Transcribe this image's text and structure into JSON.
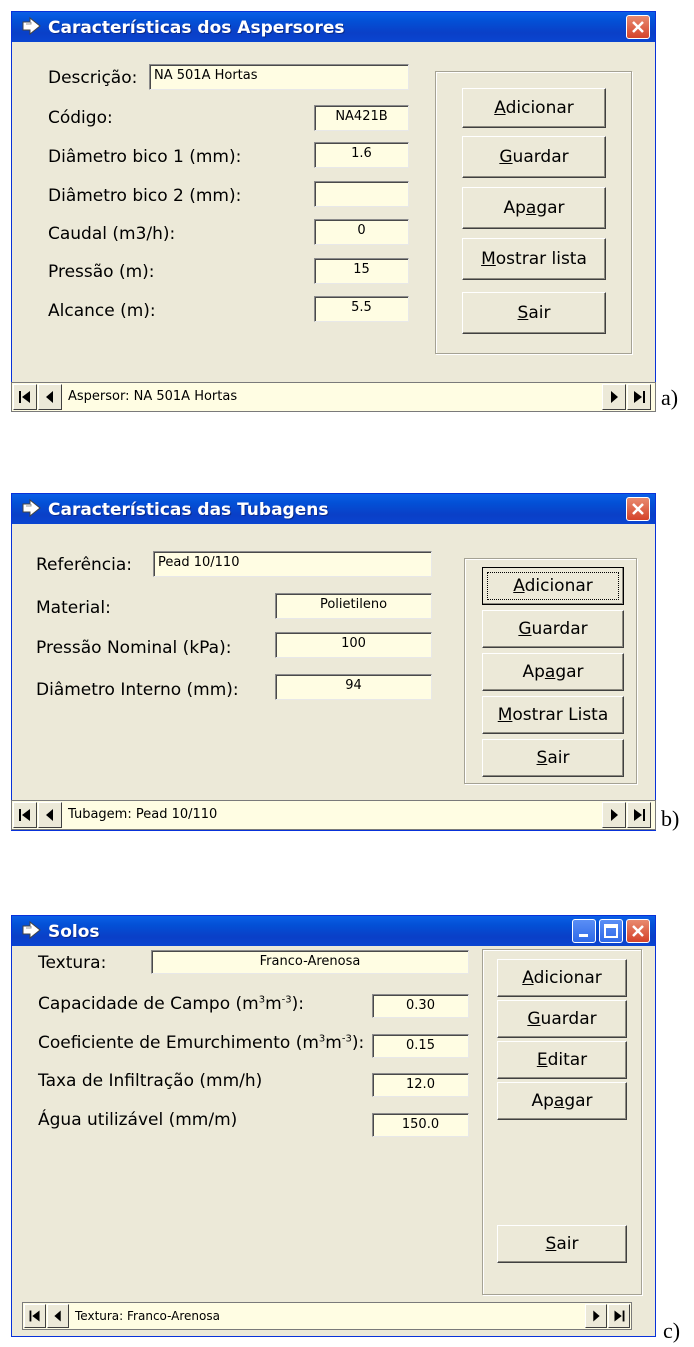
{
  "window_a": {
    "title": "Características dos Aspersores",
    "labels": {
      "descricao": "Descrição:",
      "codigo": "Código:",
      "diametro1": "Diâmetro bico 1 (mm):",
      "diametro2": "Diâmetro bico 2 (mm):",
      "caudal": "Caudal (m3/h):",
      "pressao": "Pressão (m):",
      "alcance": "Alcance (m):"
    },
    "values": {
      "descricao": "NA 501A Hortas",
      "codigo": "NA421B",
      "diametro1": "1.6",
      "diametro2": "",
      "caudal": "0",
      "pressao": "15",
      "alcance": "5.5"
    },
    "buttons": {
      "adicionar": {
        "pre": "",
        "u": "A",
        "post": "dicionar"
      },
      "guardar": {
        "pre": "",
        "u": "G",
        "post": "uardar"
      },
      "apagar": {
        "pre": "Ap",
        "u": "a",
        "post": "gar"
      },
      "mostrar": {
        "pre": "",
        "u": "M",
        "post": "ostrar lista"
      },
      "sair": {
        "pre": "",
        "u": "S",
        "post": "air"
      }
    },
    "nav_text": "Aspersor: NA 501A Hortas",
    "caption": "a)"
  },
  "window_b": {
    "title": "Características das Tubagens",
    "labels": {
      "referencia": "Referência:",
      "material": "Material:",
      "pressao": "Pressão Nominal (kPa):",
      "diametro": "Diâmetro Interno (mm):"
    },
    "values": {
      "referencia": "Pead 10/110",
      "material": "Polietileno",
      "pressao": "100",
      "diametro": "94"
    },
    "buttons": {
      "adicionar": {
        "pre": "",
        "u": "A",
        "post": "dicionar"
      },
      "guardar": {
        "pre": "",
        "u": "G",
        "post": "uardar"
      },
      "apagar": {
        "pre": "Ap",
        "u": "a",
        "post": "gar"
      },
      "mostrar": {
        "pre": "",
        "u": "M",
        "post": "ostrar Lista"
      },
      "sair": {
        "pre": "",
        "u": "S",
        "post": "air"
      }
    },
    "nav_text": "Tubagem: Pead 10/110",
    "caption": "b)"
  },
  "window_c": {
    "title": "Solos",
    "labels": {
      "textura": "Textura:",
      "capacidade_pre": "Capacidade de Campo (m",
      "coeficiente_pre": "Coeficiente de Emurchimento (m",
      "sup3": "3",
      "mid": "m",
      "supneg3": "-3",
      "close": "):",
      "taxa": "Taxa de Infiltração (mm/h)",
      "agua": "Água utilizável (mm/m)"
    },
    "values": {
      "textura": "Franco-Arenosa",
      "capacidade": "0.30",
      "coeficiente": "0.15",
      "taxa": "12.0",
      "agua": "150.0"
    },
    "buttons": {
      "adicionar": {
        "pre": "",
        "u": "A",
        "post": "dicionar"
      },
      "guardar": {
        "pre": "",
        "u": "G",
        "post": "uardar"
      },
      "editar": {
        "pre": "",
        "u": "E",
        "post": "ditar"
      },
      "apagar": {
        "pre": "Ap",
        "u": "a",
        "post": "gar"
      },
      "sair": {
        "pre": "",
        "u": "S",
        "post": "air"
      }
    },
    "nav_text": "Textura: Franco-Arenosa",
    "caption": "c)"
  },
  "colors": {
    "title_bar": "#0a5fe6",
    "window_bg": "#ece9d8",
    "field_bg": "#fffde3",
    "close_button": "#d5432a"
  }
}
